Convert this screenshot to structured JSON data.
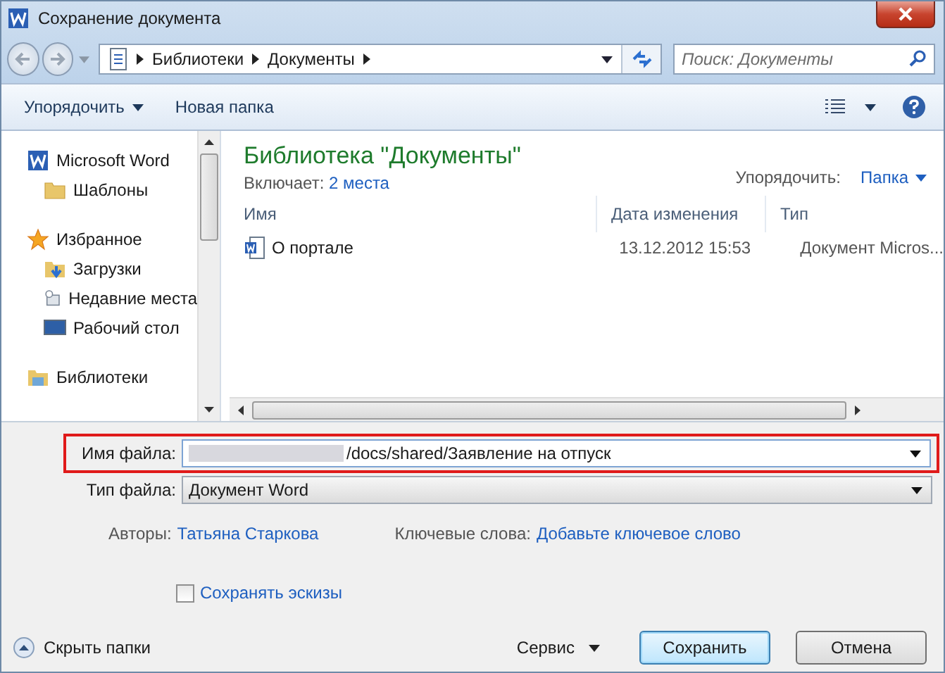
{
  "window": {
    "title": "Сохранение документа"
  },
  "breadcrumb": [
    "Библиотеки",
    "Документы"
  ],
  "search": {
    "placeholder": "Поиск: Документы"
  },
  "toolbar": {
    "organize": "Упорядочить",
    "new_folder": "Новая папка"
  },
  "sidebar": {
    "items": [
      {
        "label": "Microsoft Word",
        "kind": "word",
        "children": [
          {
            "label": "Шаблоны",
            "kind": "folder"
          }
        ]
      },
      {
        "label": "Избранное",
        "kind": "star",
        "children": [
          {
            "label": "Загрузки",
            "kind": "downloads"
          },
          {
            "label": "Недавние места",
            "kind": "recent"
          },
          {
            "label": "Рабочий стол",
            "kind": "desktop"
          }
        ]
      },
      {
        "label": "Библиотеки",
        "kind": "library"
      }
    ]
  },
  "library": {
    "title": "Библиотека \"Документы\"",
    "includes_label": "Включает:",
    "includes_link": "2 места",
    "arrange_label": "Упорядочить:",
    "arrange_value": "Папка"
  },
  "table": {
    "columns": [
      "Имя",
      "Дата изменения",
      "Тип"
    ],
    "rows": [
      {
        "name": "О портале",
        "date": "13.12.2012 15:53",
        "type": "Документ Micros..."
      }
    ]
  },
  "form": {
    "filename_label": "Имя файла:",
    "filename_value": "/docs/shared/Заявление на отпуск",
    "filetype_label": "Тип файла:",
    "filetype_value": "Документ Word",
    "authors_label": "Авторы:",
    "authors_value": "Татьяна Старкова",
    "keywords_label": "Ключевые слова:",
    "keywords_value": "Добавьте ключевое слово",
    "thumbnails": {
      "label": "Сохранять эскизы",
      "checked": false
    }
  },
  "footer": {
    "hide_folders": "Скрыть папки",
    "tools": "Сервис",
    "save": "Сохранить",
    "cancel": "Отмена"
  }
}
